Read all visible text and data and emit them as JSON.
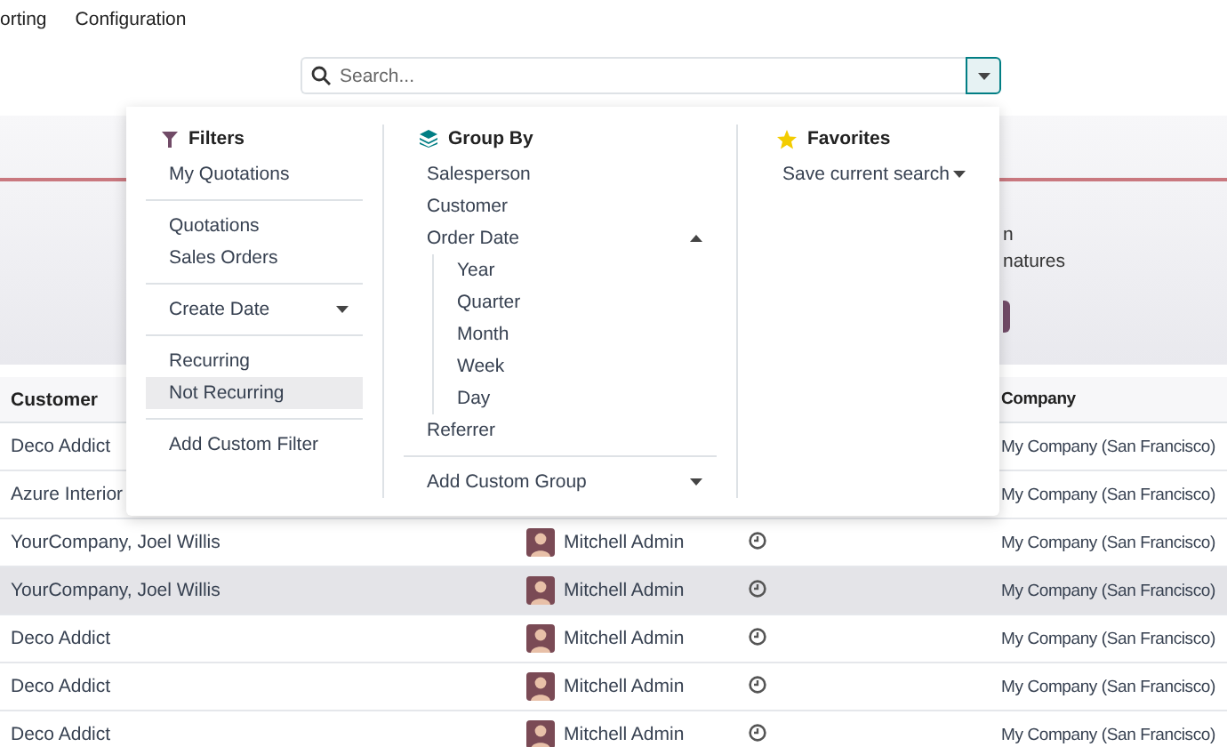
{
  "nav": [
    {
      "label": "orting"
    },
    {
      "label": "Configuration"
    }
  ],
  "search": {
    "placeholder": "Search...",
    "panel_open": true
  },
  "banner": {
    "texts": [
      "n",
      "natures"
    ]
  },
  "table": {
    "columns": [
      "Customer",
      "Company"
    ],
    "rows": [
      {
        "customer": "Deco Addict",
        "company": "My Company (San Francisco)",
        "highlighted": false
      },
      {
        "customer": "Azure Interior",
        "company": "My Company (San Francisco)",
        "highlighted": false
      },
      {
        "customer": "YourCompany, Joel Willis",
        "salesperson": "Mitchell Admin",
        "company": "My Company (San Francisco)",
        "highlighted": false
      },
      {
        "customer": "YourCompany, Joel Willis",
        "salesperson": "Mitchell Admin",
        "company": "My Company (San Francisco)",
        "highlighted": true
      },
      {
        "customer": "Deco Addict",
        "salesperson": "Mitchell Admin",
        "company": "My Company (San Francisco)",
        "highlighted": false
      },
      {
        "customer": "Deco Addict",
        "salesperson": "Mitchell Admin",
        "company": "My Company (San Francisco)",
        "highlighted": false
      },
      {
        "customer": "Deco Addict",
        "salesperson": "Mitchell Admin",
        "company": "My Company (San Francisco)",
        "highlighted": false
      }
    ]
  },
  "filters": {
    "title": "Filters",
    "groups": [
      [
        {
          "label": "My Quotations",
          "kind": "item",
          "highlighted": false
        }
      ],
      [
        {
          "label": "Quotations",
          "kind": "item",
          "highlighted": false
        },
        {
          "label": "Sales Orders",
          "kind": "item",
          "highlighted": false
        }
      ],
      [
        {
          "label": "Create Date",
          "kind": "option",
          "expanded": false,
          "highlighted": false
        }
      ],
      [
        {
          "label": "Recurring",
          "kind": "item",
          "highlighted": false
        },
        {
          "label": "Not Recurring",
          "kind": "item",
          "highlighted": true
        }
      ],
      [
        {
          "label": "Add Custom Filter",
          "kind": "item",
          "highlighted": false
        }
      ]
    ]
  },
  "group_by": {
    "title": "Group By",
    "items": [
      {
        "label": "Salesperson",
        "kind": "item"
      },
      {
        "label": "Customer",
        "kind": "item"
      },
      {
        "label": "Order Date",
        "kind": "option",
        "expanded": true,
        "children": [
          {
            "label": "Year"
          },
          {
            "label": "Quarter"
          },
          {
            "label": "Month"
          },
          {
            "label": "Week"
          },
          {
            "label": "Day"
          }
        ]
      },
      {
        "label": "Referrer",
        "kind": "item"
      }
    ],
    "footer": {
      "label": "Add Custom Group"
    }
  },
  "favorites": {
    "title": "Favorites",
    "items": [
      {
        "label": "Save current search",
        "kind": "option",
        "expanded": false
      }
    ]
  }
}
